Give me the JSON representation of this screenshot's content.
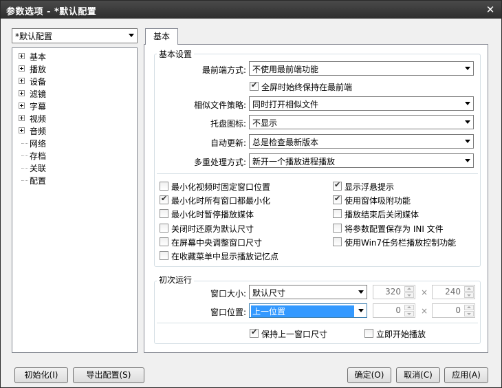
{
  "window": {
    "title": "参数选项 - *默认配置",
    "close_glyph": "✕"
  },
  "profile_combo": {
    "value": "*默认配置"
  },
  "tree": {
    "items": [
      {
        "label": "基本",
        "expandable": true
      },
      {
        "label": "播放",
        "expandable": true
      },
      {
        "label": "设备",
        "expandable": true
      },
      {
        "label": "滤镜",
        "expandable": true
      },
      {
        "label": "字幕",
        "expandable": true
      },
      {
        "label": "视频",
        "expandable": true
      },
      {
        "label": "音频",
        "expandable": true
      },
      {
        "label": "网络",
        "expandable": false
      },
      {
        "label": "存档",
        "expandable": false
      },
      {
        "label": "关联",
        "expandable": false
      },
      {
        "label": "配置",
        "expandable": false
      }
    ]
  },
  "tab": {
    "label": "基本"
  },
  "basic": {
    "group_title": "基本设置",
    "topmost": {
      "label": "最前端方式:",
      "value": "不使用最前端功能"
    },
    "fullscreen_topmost": {
      "label": "全屏时始终保持在最前端",
      "checked": true
    },
    "similar_files": {
      "label": "相似文件策略:",
      "value": "同时打开相似文件"
    },
    "tray_icon": {
      "label": "托盘图标:",
      "value": "不显示"
    },
    "auto_update": {
      "label": "自动更新:",
      "value": "总是检查最新版本"
    },
    "multi_process": {
      "label": "多重处理方式:",
      "value": "新开一个播放进程播放"
    },
    "checkboxes_left": [
      {
        "label": "最小化视频时固定窗口位置",
        "checked": false
      },
      {
        "label": "最小化时所有窗口都最小化",
        "checked": true
      },
      {
        "label": "最小化时暂停播放媒体",
        "checked": false
      },
      {
        "label": "关闭时还原为默认尺寸",
        "checked": false
      },
      {
        "label": "在屏幕中央调整窗口尺寸",
        "checked": false
      },
      {
        "label": "在收藏菜单中显示播放记忆点",
        "checked": false
      }
    ],
    "checkboxes_right": [
      {
        "label": "显示浮悬提示",
        "checked": true
      },
      {
        "label": "使用窗体吸附功能",
        "checked": true
      },
      {
        "label": "播放结束后关闭媒体",
        "checked": false
      },
      {
        "label": "将参数配置保存为 INI 文件",
        "checked": false
      },
      {
        "label": "使用Win7任务栏播放控制功能",
        "checked": false
      }
    ]
  },
  "first_run": {
    "group_title": "初次运行",
    "window_size": {
      "label": "窗口大小:",
      "value": "默认尺寸",
      "width": "320",
      "height": "240"
    },
    "window_pos": {
      "label": "窗口位置:",
      "value": "上一位置",
      "x": "0",
      "y": "0"
    },
    "times_glyph": "×",
    "keep_last_size": {
      "label": "保持上一窗口尺寸",
      "checked": true
    },
    "play_immediately": {
      "label": "立即开始播放",
      "checked": false
    }
  },
  "buttons": {
    "init": "初始化(I)",
    "export": "导出配置(S)",
    "ok": "确定(O)",
    "cancel": "取消(C)",
    "apply": "应用(A)"
  }
}
